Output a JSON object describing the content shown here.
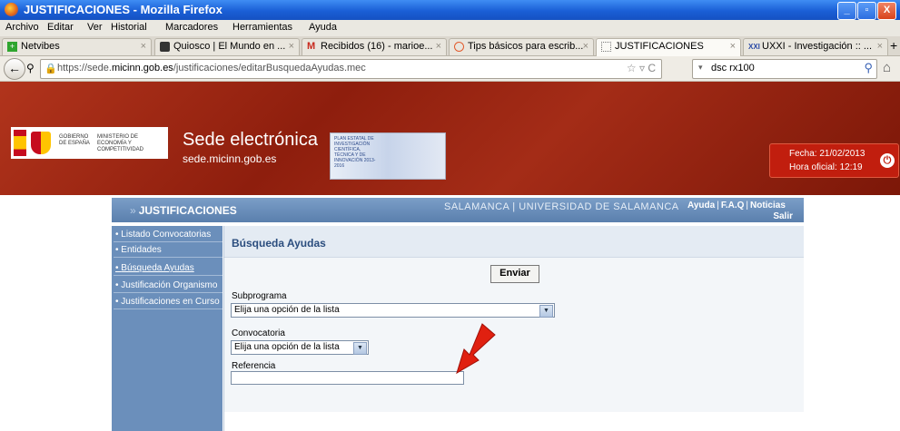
{
  "window": {
    "title": "JUSTIFICACIONES - Mozilla Firefox",
    "buttons": {
      "minimize": "_",
      "maximize": "▫",
      "close": "X"
    }
  },
  "menu": [
    "Archivo",
    "Editar",
    "Ver",
    "Historial",
    "Marcadores",
    "Herramientas",
    "Ayuda"
  ],
  "bookmark": {
    "label": "Netvibes"
  },
  "tabs": [
    {
      "label": "Quiosco | El Mundo en ..."
    },
    {
      "label": "Recibidos (16) - marioe..."
    },
    {
      "label": "Tips básicos para escrib..."
    },
    {
      "label": "JUSTIFICACIONES"
    },
    {
      "label": "UXXI - Investigación :: ..."
    }
  ],
  "newtab": "+",
  "urlbar": {
    "prefix": "https://sede.",
    "domain": "micinn.gob.es",
    "path": "/justificaciones/editarBusquedaAyudas.mec"
  },
  "search": {
    "value": "dsc rx100"
  },
  "header": {
    "gob_text": "GOBIERNO DE ESPAÑA",
    "min_text": "MINISTERIO DE ECONOMÍA Y COMPETITIVIDAD",
    "title": "Sede electrónica",
    "subtitle": "sede.micinn.gob.es",
    "plan_text": "PLAN ESTATAL DE INVESTIGACIÓN CIENTÍFICA, TÉCNICA Y DE INNOVACIÓN 2013-2016",
    "fecha": "Fecha: 21/02/2013",
    "hora": "Hora oficial: 12:19"
  },
  "app": {
    "title": "JUSTIFICACIONES",
    "organization": "SALAMANCA | UNIVERSIDAD DE SALAMANCA",
    "links": {
      "ayuda": "Ayuda",
      "faq": "F.A.Q",
      "noticias": "Noticias",
      "salir": "Salir"
    }
  },
  "sidebar": {
    "items": [
      {
        "label": "Listado Convocatorias"
      },
      {
        "label": "Entidades"
      },
      {
        "label": "Búsqueda Ayudas"
      },
      {
        "label": "Justificación Organismo"
      },
      {
        "label": "Justificaciones en Curso"
      }
    ]
  },
  "main": {
    "title": "Búsqueda Ayudas",
    "submit_label": "Enviar",
    "fields": {
      "subprograma": {
        "label": "Subprograma",
        "value": "Elija una opción de la lista"
      },
      "convocatoria": {
        "label": "Convocatoria",
        "value": "Elija una opción de la lista"
      },
      "referencia": {
        "label": "Referencia",
        "value": ""
      }
    }
  },
  "colors": {
    "header_red": "#a42c17",
    "app_blue": "#6b8fbb",
    "annotation_arrow": "#e02010"
  }
}
